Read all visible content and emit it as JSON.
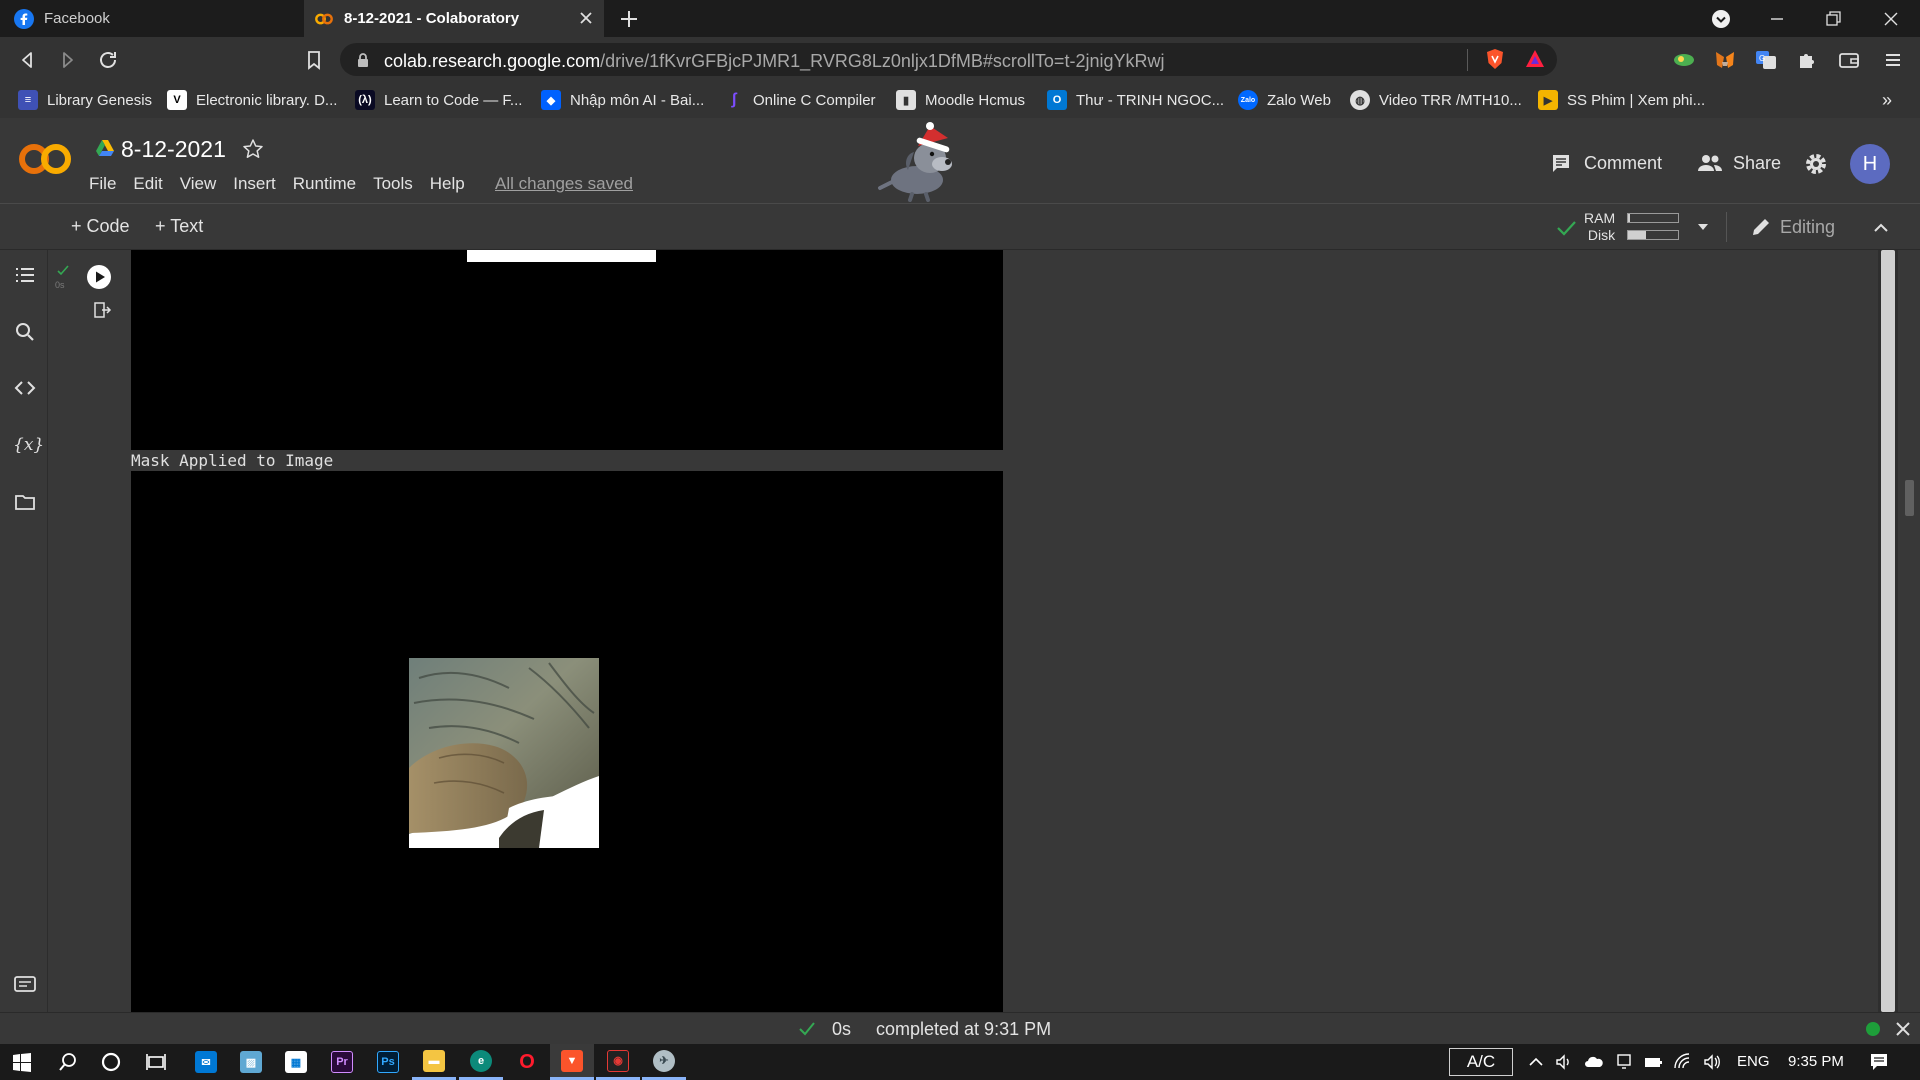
{
  "browser": {
    "tabs": [
      {
        "title": "Facebook"
      },
      {
        "title": "8-12-2021 - Colaboratory"
      }
    ],
    "url_host": "colab.research.google.com",
    "url_rest": "/drive/1fKvrGFBjcPJMR1_RVRG8Lz0nljx1DfMB#scrollTo=t-2jnigYkRwj",
    "bookmarks": [
      {
        "label": "Library Genesis",
        "icon": "library-icon"
      },
      {
        "label": "Electronic library. D...",
        "icon": "v-icon"
      },
      {
        "label": "Learn to Code — F...",
        "icon": "fcc-icon"
      },
      {
        "label": "Nhập môn AI - Bai...",
        "icon": "dropbox-icon"
      },
      {
        "label": "Online C Compiler",
        "icon": "compiler-icon"
      },
      {
        "label": "Moodle Hcmus",
        "icon": "moodle-icon"
      },
      {
        "label": "Thư - TRINH NGOC...",
        "icon": "outlook-icon"
      },
      {
        "label": "Zalo Web",
        "icon": "zalo-icon"
      },
      {
        "label": "Video TRR /MTH10...",
        "icon": "globe-icon"
      },
      {
        "label": "SS Phim | Xem phi...",
        "icon": "film-icon"
      }
    ]
  },
  "colab": {
    "doc_title": "8-12-2021",
    "menus": [
      "File",
      "Edit",
      "View",
      "Insert",
      "Runtime",
      "Tools",
      "Help"
    ],
    "saved_status": "All changes saved",
    "comment_label": "Comment",
    "share_label": "Share",
    "avatar_letter": "H",
    "add_code": "+ Code",
    "add_text": "+ Text",
    "ram_label": "RAM",
    "disk_label": "Disk",
    "ram_usage": 0.04,
    "disk_usage": 0.35,
    "editing_label": "Editing"
  },
  "cell": {
    "exec_time": "0s",
    "output_label": "Mask Applied to Image"
  },
  "status": {
    "time": "0s",
    "completed": "completed at 9:31 PM"
  },
  "taskbar": {
    "ac_label": "A/C",
    "language": "ENG",
    "clock": "9:35 PM"
  },
  "colors": {
    "colab_orange": "#f9ab00",
    "accent_blue": "#8ab4f8",
    "ok_green": "#1e9e3a"
  }
}
